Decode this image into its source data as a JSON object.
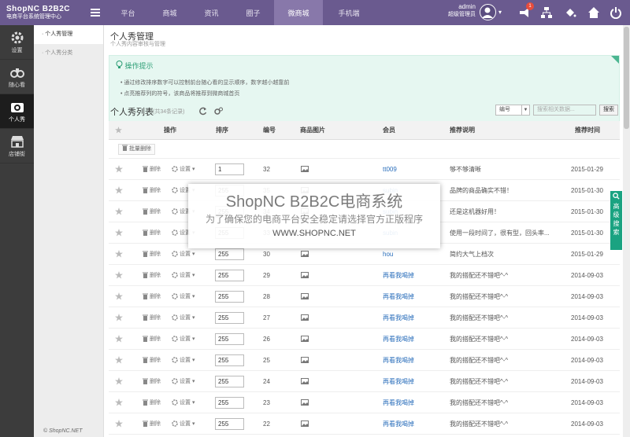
{
  "header": {
    "brand": "ShopNC B2B2C",
    "brand_sub": "电商平台系统管理中心",
    "nav": [
      "平台",
      "商城",
      "资讯",
      "圈子",
      "微商城",
      "手机端"
    ],
    "user_name": "admin",
    "user_role": "超级管理员",
    "badge_count": "1"
  },
  "sidebar": [
    {
      "label": "设置",
      "icon": "gear-icon"
    },
    {
      "label": "随心看",
      "icon": "binoculars-icon"
    },
    {
      "label": "个人秀",
      "icon": "camera-icon"
    },
    {
      "label": "店铺街",
      "icon": "store-icon"
    }
  ],
  "subnav": [
    "个人秀管理",
    "个人秀分类"
  ],
  "footer": "© ShopNC.NET",
  "page": {
    "title": "个人秀管理",
    "subtitle": "个人秀内容审核与管理"
  },
  "tips": {
    "title": "操作提示",
    "items": [
      "通过修改排序数字可以控制前台随心看的显示顺序，数字越小越靠前",
      "点亮推荐列的符号，该商品将推荐到微商城首页"
    ]
  },
  "list": {
    "title": "个人秀列表",
    "count": "(共34条记录)",
    "filter_select": "编号",
    "search_placeholder": "搜索相关数据...",
    "search_label": "搜索",
    "batch_delete": "批量删除"
  },
  "columns": [
    "操作",
    "排序",
    "编号",
    "商品图片",
    "会员",
    "推荐说明",
    "推荐时间"
  ],
  "row_actions": {
    "delete": "删除",
    "settings": "设置"
  },
  "rows": [
    {
      "sort": "1",
      "id": "32",
      "member": "tt009",
      "desc": "够不够清晰",
      "time": "2015-01-29"
    },
    {
      "sort": "255",
      "id": "35",
      "member": "subin",
      "desc": "品牌的商品确实不错！",
      "time": "2015-01-30"
    },
    {
      "sort": "255",
      "id": "34",
      "member": "subin",
      "desc": "还是这机器好用！",
      "time": "2015-01-30"
    },
    {
      "sort": "255",
      "id": "33",
      "member": "subin",
      "desc": "使用一段时间了，很有型，回头率...",
      "time": "2015-01-30"
    },
    {
      "sort": "255",
      "id": "30",
      "member": "hou",
      "desc": "简约大气上档次",
      "time": "2015-01-29"
    },
    {
      "sort": "255",
      "id": "29",
      "member": "再看我喝掉",
      "desc": "我的搭配还不错吧^-^",
      "time": "2014-09-03"
    },
    {
      "sort": "255",
      "id": "28",
      "member": "再看我喝掉",
      "desc": "我的搭配还不错吧^-^",
      "time": "2014-09-03"
    },
    {
      "sort": "255",
      "id": "27",
      "member": "再看我喝掉",
      "desc": "我的搭配还不错吧^-^",
      "time": "2014-09-03"
    },
    {
      "sort": "255",
      "id": "26",
      "member": "再看我喝掉",
      "desc": "我的搭配还不错吧^-^",
      "time": "2014-09-03"
    },
    {
      "sort": "255",
      "id": "25",
      "member": "再看我喝掉",
      "desc": "我的搭配还不错吧^-^",
      "time": "2014-09-03"
    },
    {
      "sort": "255",
      "id": "24",
      "member": "再看我喝掉",
      "desc": "我的搭配还不错吧^-^",
      "time": "2014-09-03"
    },
    {
      "sort": "255",
      "id": "23",
      "member": "再看我喝掉",
      "desc": "我的搭配还不错吧^-^",
      "time": "2014-09-03"
    },
    {
      "sort": "255",
      "id": "22",
      "member": "再看我喝掉",
      "desc": "我的搭配还不错吧^-^",
      "time": "2014-09-03"
    }
  ],
  "overlay": {
    "line1": "ShopNC B2B2C电商系统",
    "line2": "为了确保您的电商平台安全稳定请选择官方正版程序",
    "line3": "WWW.SHOPNC.NET"
  },
  "advanced_search": "高级搜索",
  "colors": {
    "header": "#6a5a8f",
    "accent": "#1aa381",
    "link": "#2a6ebb"
  }
}
